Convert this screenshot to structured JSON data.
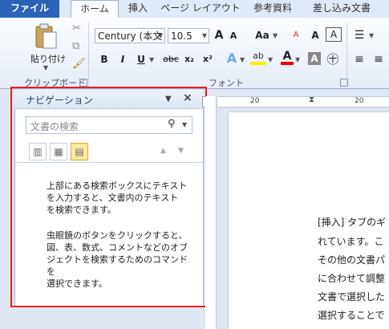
{
  "tabs": [
    {
      "label": "ファイル"
    },
    {
      "label": "ホーム"
    },
    {
      "label": "挿入"
    },
    {
      "label": "ページ レイアウト"
    },
    {
      "label": "参考資料"
    },
    {
      "label": "差し込み文書"
    }
  ],
  "clipboard": {
    "paste_label": "貼り付け",
    "group_label": "クリップボード"
  },
  "font": {
    "name_value": "Century (本文",
    "size_value": "10.5",
    "group_label": "フォント",
    "format_buttons": [
      "B",
      "I",
      "U",
      "abc",
      "x₂",
      "x²"
    ],
    "grow_label": "A",
    "shrink_label": "A",
    "case_label": "Aa",
    "clear_label": "A",
    "box_label": "A"
  },
  "nav": {
    "title": "ナビゲーション",
    "search_placeholder": "文書の検索",
    "help_text_1": "上部にある検索ボックスにテキスト\nを入力すると、文書内のテキスト\nを検索できます。",
    "help_text_2": "虫眼鏡のボタンをクリックすると、\n図、表、数式、コメントなどのオブ\nジェクトを検索するためのコマンドを\n選択できます。"
  },
  "document": {
    "lines": [
      "[挿入] タブのギ",
      "れています。こ",
      "その他の文書パ",
      "に合わせて調整",
      "文書で選択した",
      "選択することで"
    ]
  },
  "ruler": {
    "tick_label": "20"
  }
}
